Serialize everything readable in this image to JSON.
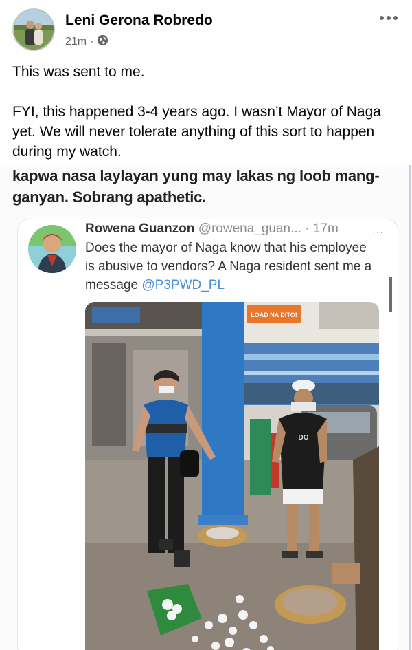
{
  "post": {
    "author": "Leni Gerona Robredo",
    "time": "21m",
    "privacy_icon": "globe-icon",
    "more_icon": "more-dots-icon",
    "paragraphs": [
      "This was sent to me.",
      "FYI, this happened 3-4 years ago. I wasn’t Mayor of Naga yet. We will never tolerate anything of this sort to happen during my watch."
    ]
  },
  "shared_image": {
    "caption": "kapwa nasa laylayan yung may lakas ng loob mang-ganyan. Sobrang apathetic.",
    "tweet": {
      "name": "Rowena Guanzon",
      "handle": "@rowena_guan...",
      "time": "· 17m",
      "body": "Does the mayor of Naga know that his employee is abusive to vendors? A Naga resident sent me a message ",
      "mention": "@P3PWD_PL",
      "more": "···"
    },
    "photo": {
      "store_sign": "LOAD NA DITO!",
      "shirt_text": "DO"
    }
  },
  "colors": {
    "text_primary": "#050505",
    "text_secondary": "#65676b",
    "mention_blue": "#4a90d9",
    "pillar_blue": "#2f78c4"
  }
}
